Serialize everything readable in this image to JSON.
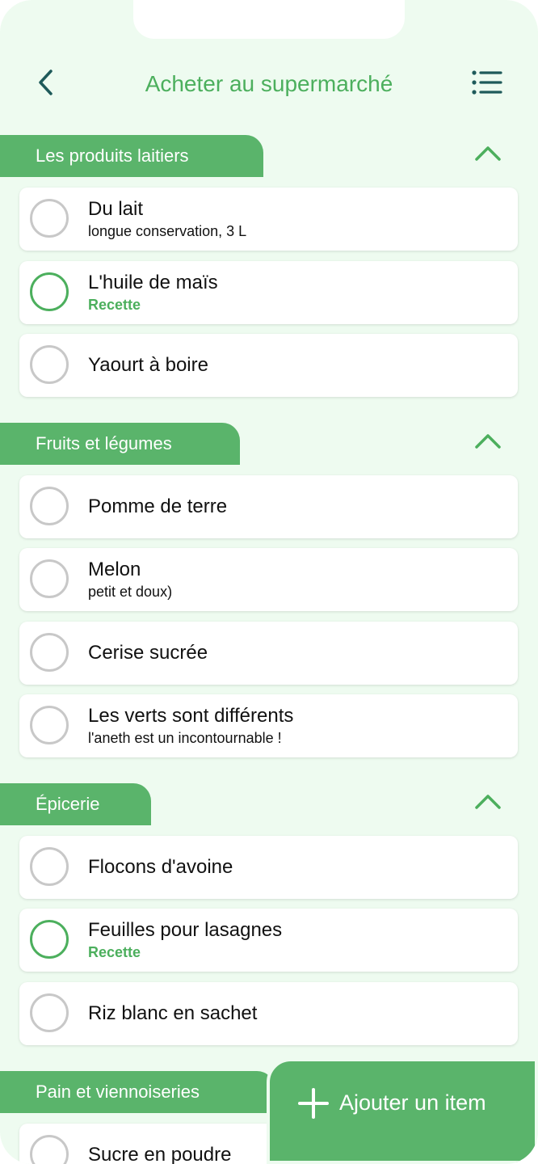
{
  "header": {
    "title": "Acheter au supermarché",
    "back_icon": "chevron-left-icon",
    "menu_icon": "list-icon"
  },
  "colors": {
    "accent": "#4caf5d",
    "tab": "#5ab46b",
    "background": "#eefbf0",
    "card": "#ffffff",
    "circle_unchecked": "#c8c8c8"
  },
  "sections": [
    {
      "title": "Les produits laitiers",
      "items": [
        {
          "title": "Du lait",
          "subtitle": "longue conservation, 3 L",
          "recipe": false
        },
        {
          "title": "L'huile de maïs",
          "subtitle": "Recette",
          "recipe": true
        },
        {
          "title": "Yaourt à boire",
          "subtitle": "",
          "recipe": false
        }
      ]
    },
    {
      "title": "Fruits et légumes",
      "items": [
        {
          "title": "Pomme de terre",
          "subtitle": "",
          "recipe": false
        },
        {
          "title": "Melon",
          "subtitle": "petit et doux)",
          "recipe": false
        },
        {
          "title": "Cerise sucrée",
          "subtitle": "",
          "recipe": false
        },
        {
          "title": "Les verts sont différents",
          "subtitle": "l'aneth est un incontournable !",
          "recipe": false
        }
      ]
    },
    {
      "title": "Épicerie",
      "items": [
        {
          "title": "Flocons d'avoine",
          "subtitle": "",
          "recipe": false
        },
        {
          "title": "Feuilles pour lasagnes",
          "subtitle": "Recette",
          "recipe": true
        },
        {
          "title": "Riz blanc en sachet",
          "subtitle": "",
          "recipe": false
        }
      ]
    },
    {
      "title": "Pain et viennoiseries",
      "items": [
        {
          "title": "Sucre en poudre",
          "subtitle": "",
          "recipe": false
        }
      ]
    }
  ],
  "add_button": {
    "label": "Ajouter un item",
    "icon": "plus-icon"
  }
}
